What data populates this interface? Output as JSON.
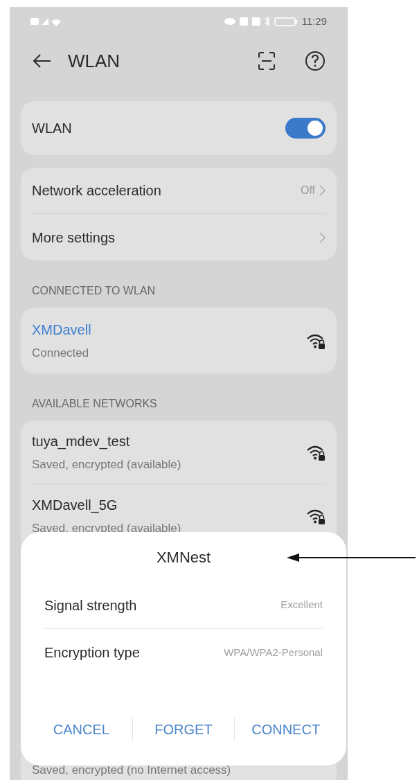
{
  "status_bar": {
    "time": "11:29"
  },
  "header": {
    "title": "WLAN"
  },
  "wlan_toggle": {
    "label": "WLAN",
    "on": true
  },
  "settings": [
    {
      "label": "Network acceleration",
      "value": "Off"
    },
    {
      "label": "More settings"
    }
  ],
  "connected": {
    "heading": "CONNECTED TO WLAN",
    "network": {
      "name": "XMDavell",
      "status": "Connected"
    }
  },
  "available": {
    "heading": "AVAILABLE NETWORKS",
    "networks": [
      {
        "name": "tuya_mdev_test",
        "status": "Saved, encrypted (available)"
      },
      {
        "name": "XMDavell_5G",
        "status": "Saved, encrypted (available)"
      }
    ],
    "last_status": "Saved, encrypted (no Internet access)"
  },
  "dialog": {
    "title": "XMNest",
    "rows": [
      {
        "label": "Signal strength",
        "value": "Excellent"
      },
      {
        "label": "Encryption type",
        "value": "WPA/WPA2-Personal"
      }
    ],
    "buttons": [
      "CANCEL",
      "FORGET",
      "CONNECT"
    ]
  }
}
